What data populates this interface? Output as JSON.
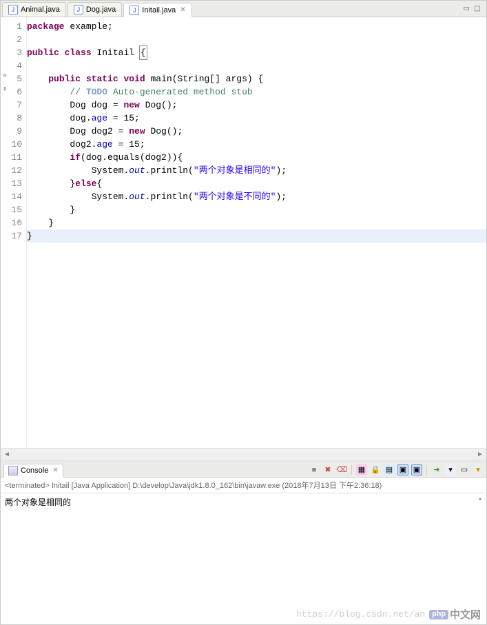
{
  "tabs": [
    {
      "label": "Animal.java",
      "active": false
    },
    {
      "label": "Dog.java",
      "active": false
    },
    {
      "label": "Initail.java",
      "active": true
    }
  ],
  "code_lines": [
    {
      "n": 1,
      "html": "<span class='kw'>package</span> example;"
    },
    {
      "n": 2,
      "html": ""
    },
    {
      "n": 3,
      "html": "<span class='kw'>public</span> <span class='kw'>class</span> Initail <span class='box-highlight'>{</span>"
    },
    {
      "n": 4,
      "html": ""
    },
    {
      "n": 5,
      "html": "    <span class='kw'>public</span> <span class='kw'>static</span> <span class='kw'>void</span> main(String[] args) {"
    },
    {
      "n": 6,
      "html": "        <span class='cm'>// </span><span class='cm-tag'>TODO</span><span class='cm'> Auto-generated method stub</span>"
    },
    {
      "n": 7,
      "html": "        Dog dog = <span class='kw'>new</span> Dog();"
    },
    {
      "n": 8,
      "html": "        dog.<span class='field'>age</span> = 15;"
    },
    {
      "n": 9,
      "html": "        Dog dog2 = <span class='kw'>new</span> Dog();"
    },
    {
      "n": 10,
      "html": "        dog2.<span class='field'>age</span> = 15;"
    },
    {
      "n": 11,
      "html": "        <span class='kw'>if</span>(dog.equals(dog2)){"
    },
    {
      "n": 12,
      "html": "            System.<span class='static-ref'>out</span>.println(<span class='str'>\"两个对象是相同的\"</span>);"
    },
    {
      "n": 13,
      "html": "        }<span class='kw'>else</span>{"
    },
    {
      "n": 14,
      "html": "            System.<span class='static-ref'>out</span>.println(<span class='str'>\"两个对象是不同的\"</span>);"
    },
    {
      "n": 15,
      "html": "        }"
    },
    {
      "n": 16,
      "html": "    }"
    },
    {
      "n": 17,
      "html": "}",
      "highlight": true
    }
  ],
  "console": {
    "tab_label": "Console",
    "status": "<terminated> Initail [Java Application] D:\\develop\\Java\\jdk1.8.0_162\\bin\\javaw.exe (2018年7月13日 下午2:36:18)",
    "output": "两个对象是相同的"
  },
  "watermark": {
    "url": "https://blog.csdn.net/an",
    "brand1": "php",
    "brand2": "中文网"
  }
}
